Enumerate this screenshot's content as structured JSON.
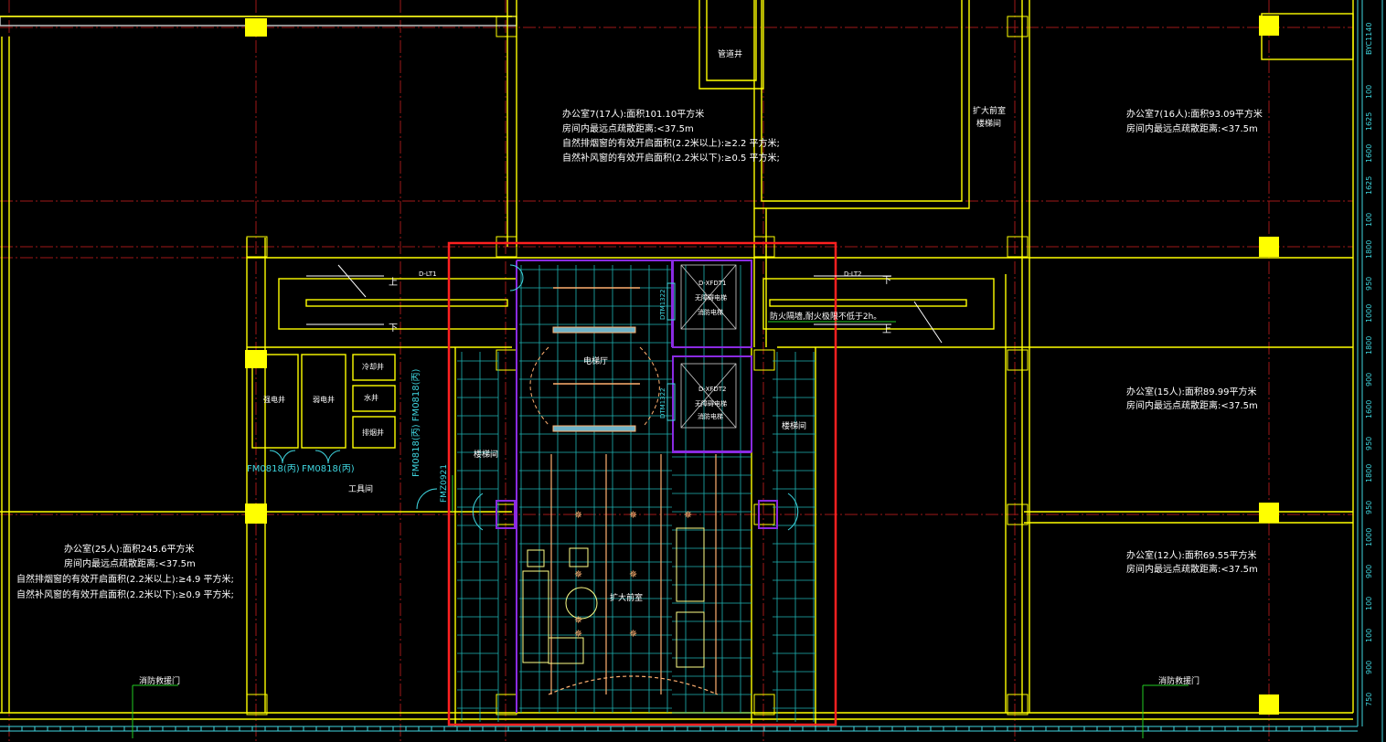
{
  "colors": {
    "background": "#000000",
    "wall": "#ffff00",
    "grid_axis": "#a01818",
    "door": "#3fd6e0",
    "floor_tile": "#1fb4b4",
    "purple": "#8a2be2",
    "highlight": "#ff2020",
    "text": "#ffffff",
    "ceiling_light": "#ffb070"
  },
  "rooms": {
    "office7": [
      "办公室7(17人):面积101.10平方米",
      "房间内最远点疏散距离:<37.5m",
      "自然排烟窗的有效开启面积(2.2米以上):≥2.2 平方米;",
      "自然补风窗的有效开启面积(2.2米以下):≥0.5 平方米;"
    ],
    "office_top_right": [
      "办公室7(16人):面积93.09平方米",
      "房间内最远点疏散距离:<37.5m"
    ],
    "office_mid_right": [
      "办公室(15人):面积89.99平方米",
      "房间内最远点疏散距离:<37.5m"
    ],
    "office_low_right": [
      "办公室(12人):面积69.55平方米",
      "房间内最远点疏散距离:<37.5m"
    ],
    "office_left": [
      "办公室(25人):面积245.6平方米",
      "房间内最远点疏散距离:<37.5m",
      "自然排烟窗的有效开启面积(2.2米以上):≥4.9 平方米;",
      "自然补风窗的有效开启面积(2.2米以下):≥0.9 平方米;"
    ],
    "fire_stair_top": [
      "扩大前室",
      "楼梯间"
    ],
    "pipe_shaft": "管道井",
    "elevator_hall": "电梯厅",
    "enlarged_lobby": "扩大前室",
    "stair_room_left": "楼梯间",
    "stair_room_right": "楼梯间",
    "tool_room": "工具间",
    "strong_elec": "强电井",
    "weak_elec": "弱电井",
    "cold_water": "冷却井",
    "water_well": "水井",
    "smoke_well": "排烟井",
    "fire_rescue_door_left": "消防救援门",
    "fire_rescue_door_right": "消防救援门",
    "fire_wall_note": "防火隔墙,耐火极限不低于2h。",
    "fire_elevator_1": [
      "D-XFDT1",
      "无障碍电梯",
      "消防电梯"
    ],
    "fire_elevator_2": [
      "D-XFDT2",
      "无障碍电梯",
      "消防电梯"
    ]
  },
  "labels": {
    "stair_up": "上",
    "stair_down": "下",
    "stair_left_id": "D-LT1",
    "stair_right_id": "D-LT2",
    "door_fm0818_a": "FM0818(丙)",
    "door_fm0818_b": "FM0818(丙)",
    "door_fm0818_vertical": "FM0818(丙) FM0818(丙)",
    "door_fm_a0921": "FMZ0921",
    "door_d1": "DTM1322",
    "door_d2": "DTM1322",
    "right_column": "BYC1140"
  },
  "dimensions_right": [
    "100",
    "1625",
    "1600",
    "1625",
    "100",
    "1800",
    "950",
    "1000",
    "1800",
    "900",
    "1600",
    "950",
    "1800",
    "950",
    "1000",
    "900",
    "100",
    "100",
    "900",
    "750"
  ],
  "highlight_box_note": ""
}
